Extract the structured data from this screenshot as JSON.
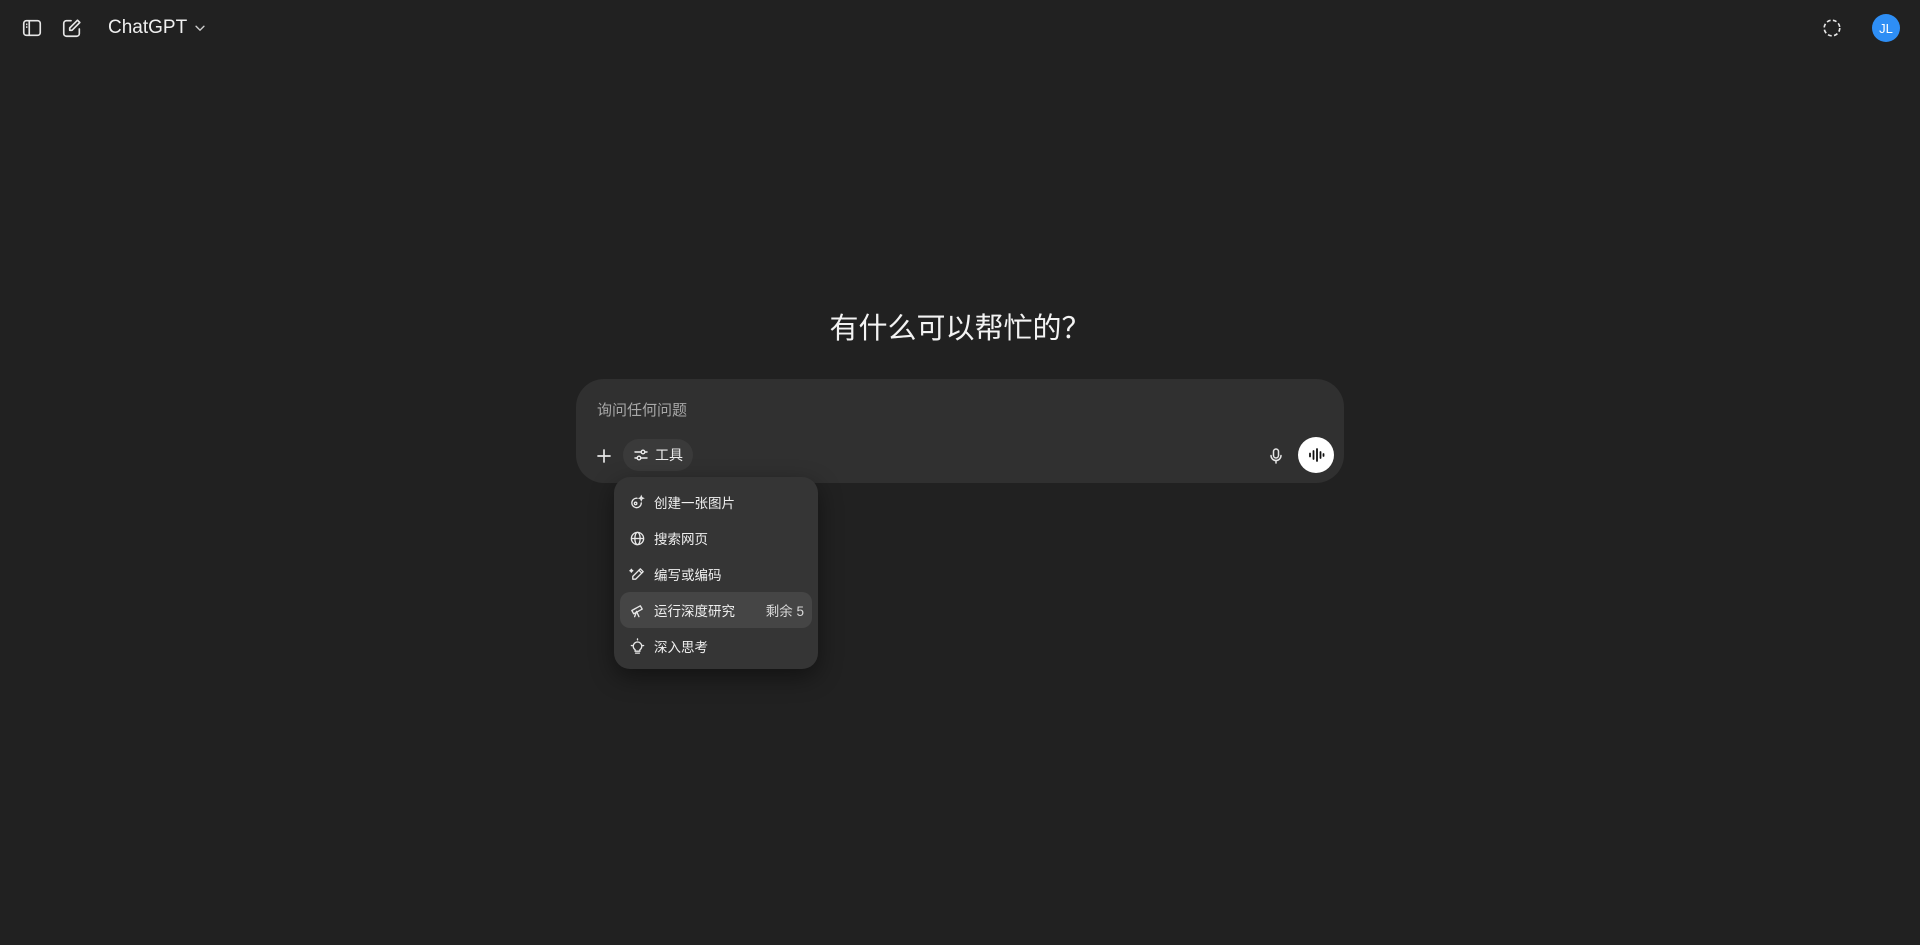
{
  "header": {
    "model_name": "ChatGPT",
    "avatar_initials": "JL",
    "avatar_color": "#2e8ef5"
  },
  "main": {
    "headline": "有什么可以帮忙的？"
  },
  "composer": {
    "placeholder": "询问任何问题",
    "tools_label": "工具"
  },
  "tools_menu": {
    "items": [
      {
        "label": "创建一张图片",
        "icon": "image-sparkle-icon"
      },
      {
        "label": "搜索网页",
        "icon": "globe-icon"
      },
      {
        "label": "编写或编码",
        "icon": "pen-icon"
      },
      {
        "label": "运行深度研究",
        "icon": "telescope-icon",
        "badge": "剩余 5"
      },
      {
        "label": "深入思考",
        "icon": "lightbulb-icon"
      }
    ]
  },
  "colors": {
    "background": "#212121",
    "composer": "#303030",
    "menu": "#353535"
  }
}
